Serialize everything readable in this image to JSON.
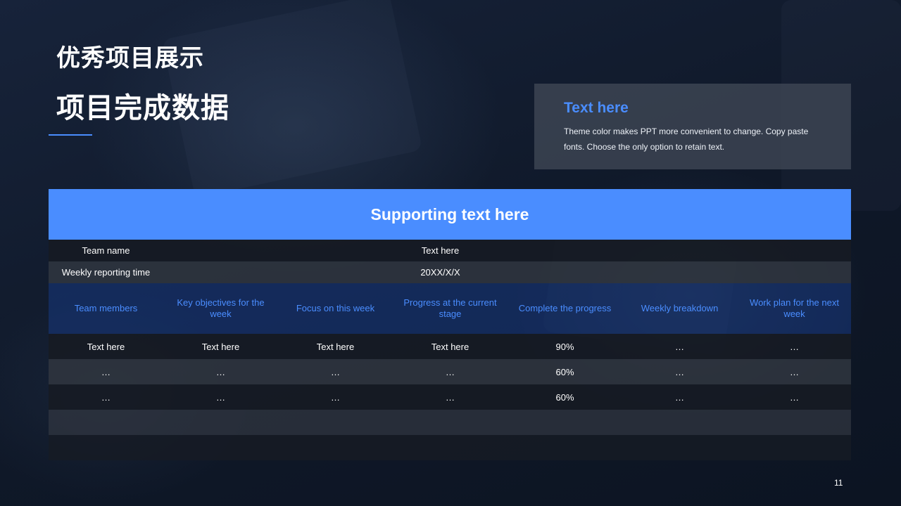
{
  "slide": {
    "title_line1": "优秀项目展示",
    "title_line2": "项目完成数据",
    "page_number": "11"
  },
  "info_box": {
    "heading": "Text here",
    "body": "Theme color makes PPT more convenient to change. Copy paste fonts. Choose the only option to retain text."
  },
  "table": {
    "header": "Supporting text here",
    "meta": [
      {
        "label": "Team name",
        "value": "Text here"
      },
      {
        "label": "Weekly reporting time",
        "value": "20XX/X/X"
      }
    ],
    "columns": [
      "Team members",
      "Key objectives for the week",
      "Focus on this week",
      "Progress at the current stage",
      "Complete the progress",
      "Weekly breakdown",
      "Work plan for the next week"
    ],
    "rows": [
      [
        "Text here",
        "Text here",
        "Text here",
        "Text here",
        "90%",
        "…",
        "…"
      ],
      [
        "…",
        "…",
        "…",
        "…",
        "60%",
        "…",
        "…"
      ],
      [
        "…",
        "…",
        "…",
        "…",
        "60%",
        "…",
        "…"
      ]
    ]
  },
  "colors": {
    "accent": "#4a8dff",
    "background": "#101a2a"
  }
}
